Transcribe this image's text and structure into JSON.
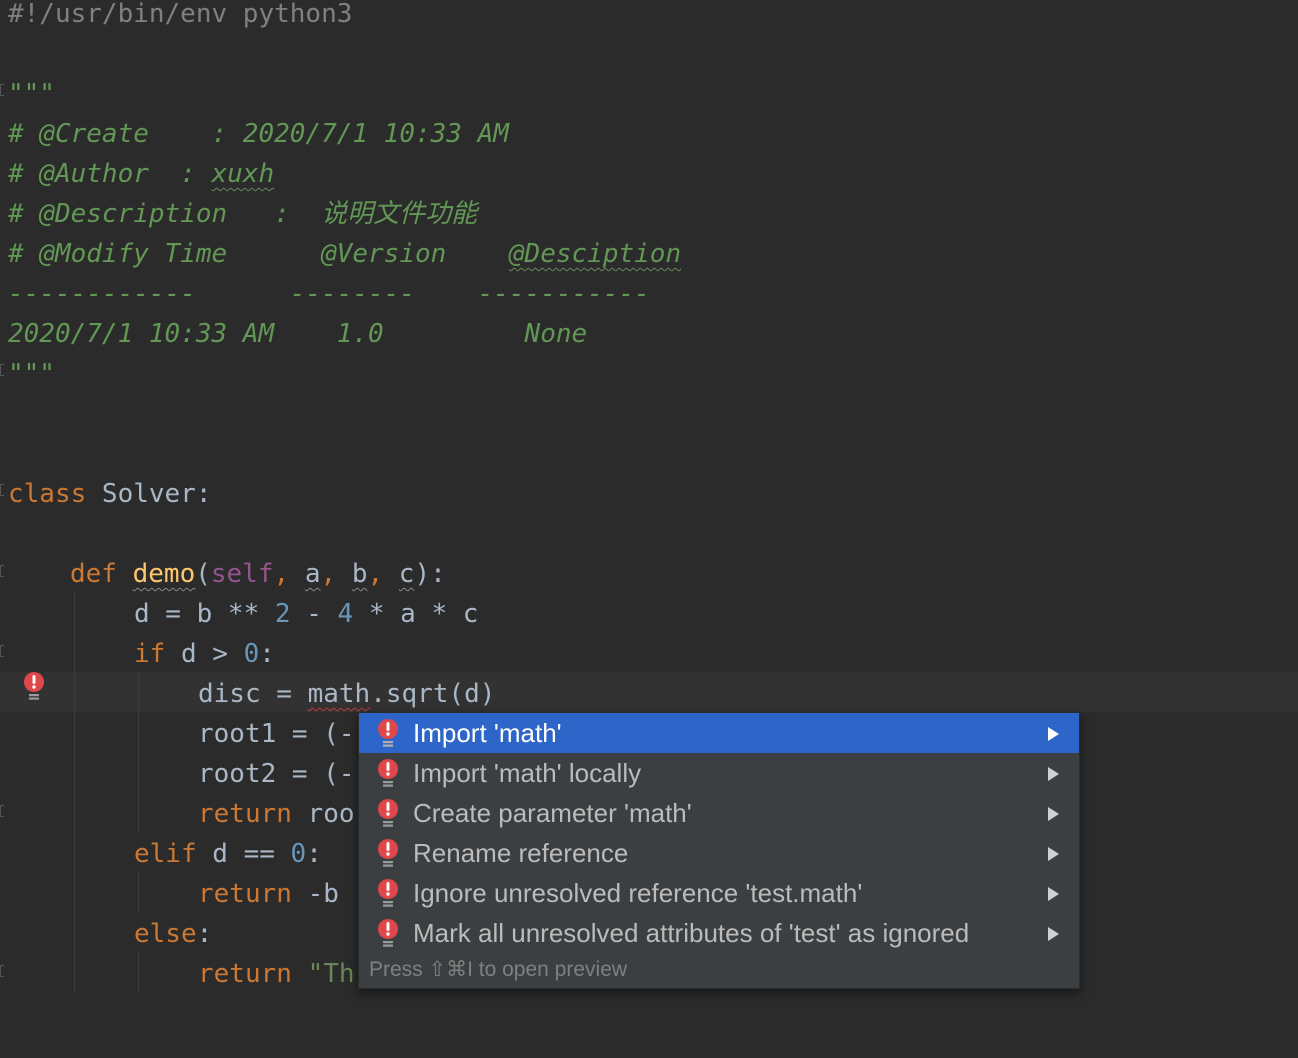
{
  "code": {
    "shebang": "#!/usr/bin/env python3",
    "doc_open": "\"\"\"",
    "doc_create": "# @Create    : 2020/7/1 10:33 AM",
    "doc_author_prefix": "# @Author  : ",
    "doc_author_name": "xuxh",
    "doc_desc": "# @Description   :  说明文件功能",
    "doc_modify_prefix": "# @Modify Time      @Version    ",
    "doc_modify_desc": "@Desciption",
    "doc_dashes": "------------      --------    -----------",
    "doc_row": "2020/7/1 10:33 AM    1.0         None",
    "doc_close": "\"\"\"",
    "kw_class": "class",
    "class_name": " Solver:",
    "kw_def": "def",
    "fn_name": "demo",
    "paren_open": "(",
    "self": "self",
    "comma": ", ",
    "param_a": "a",
    "param_b": "b",
    "param_c": "c",
    "paren_close": "):",
    "d_assign": "d = b ** ",
    "num_2": "2",
    "minus": " - ",
    "num_4": "4",
    "d_rest": " * a * c",
    "kw_if": "if",
    "if_cond": " d > ",
    "num_0": "0",
    "colon": ":",
    "disc_prefix": "disc = ",
    "math": "math",
    "disc_rest": ".sqrt(d)",
    "root1": "root1 = (-",
    "root2": "root2 = (-",
    "kw_return": "return",
    "return_roo": " roo",
    "kw_elif": "elif",
    "elif_cond": " d == ",
    "return_b": " -b",
    "kw_else": "else",
    "return_str": " \"Th"
  },
  "popup": {
    "items": [
      {
        "label": "Import 'math'"
      },
      {
        "label": "Import 'math' locally"
      },
      {
        "label": "Create parameter 'math'"
      },
      {
        "label": "Rename reference"
      },
      {
        "label": "Ignore unresolved reference 'test.math'"
      },
      {
        "label": "Mark all unresolved attributes of 'test' as ignored"
      }
    ],
    "hint": "Press ⇧⌘I to open preview"
  },
  "icons": {
    "gutter": "error-bulb-icon",
    "item": "error-bulb-icon",
    "submenu": "submenu-arrow-icon"
  },
  "colors": {
    "keyword": "#cc7832",
    "docstring": "#629755",
    "selection": "#2d65c9",
    "error": "#e0474b"
  }
}
